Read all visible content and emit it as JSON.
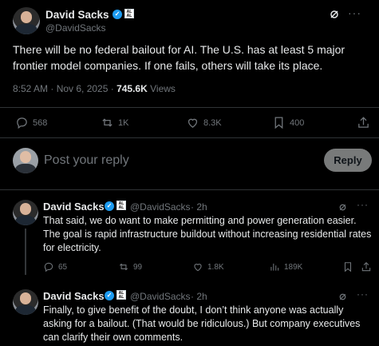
{
  "main_post": {
    "author_name": "David Sacks",
    "author_handle": "@DavidSacks",
    "text": "There will be no federal bailout for AI. The U.S. has at least 5 major frontier model companies. If one fails, others will take its place.",
    "timestamp": "8:52 AM · Nov 6, 2025 · ",
    "views_count": "745.6K",
    "views_label": " Views",
    "replies": "568",
    "reposts": "1K",
    "likes": "8.3K",
    "bookmarks": "400"
  },
  "composer": {
    "placeholder": "Post your reply",
    "button_label": "Reply"
  },
  "replies": [
    {
      "author_name": "David Sacks",
      "author_handle": "@DavidSacks",
      "age": "· 2h",
      "text": "That said, we do want to make permitting and power generation easier. The goal is rapid infrastructure buildout without increasing residential rates for electricity.",
      "replies": "65",
      "reposts": "99",
      "likes": "1.8K",
      "views": "189K"
    },
    {
      "author_name": "David Sacks",
      "author_handle": "@DavidSacks",
      "age": "· 2h",
      "text": "Finally, to give benefit of the doubt, I don’t think anyone was actually asking for a bailout. (That would be ridiculous.) But company executives can clarify their own comments."
    }
  ],
  "badges": {
    "affiliation_text": "AL AL",
    "accent": "#1d9bf0"
  },
  "icons": [
    "grok-icon",
    "more-icon",
    "reply-icon",
    "repost-icon",
    "like-icon",
    "bookmark-icon",
    "share-icon",
    "views-icon",
    "verified-badge"
  ]
}
